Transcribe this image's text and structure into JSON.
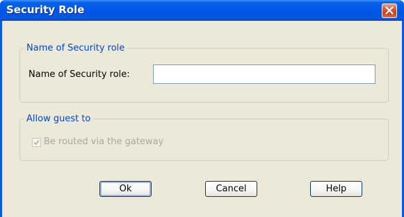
{
  "window": {
    "title": "Security Role",
    "close_icon": "close-icon"
  },
  "name_group": {
    "legend": "Name of Security role",
    "field_label": "Name of Security role:",
    "field_value": ""
  },
  "guest_group": {
    "legend": "Allow guest to",
    "checkbox_label": "Be routed via the gateway",
    "checkbox_checked": true,
    "checkbox_enabled": false
  },
  "buttons": {
    "ok": "Ok",
    "cancel": "Cancel",
    "help": "Help"
  },
  "colors": {
    "title_bar": "#0054e3",
    "dialog_face": "#ece9d8",
    "group_legend": "#0046d5",
    "close_button": "#d95b3e",
    "disabled_text": "#aca899"
  }
}
